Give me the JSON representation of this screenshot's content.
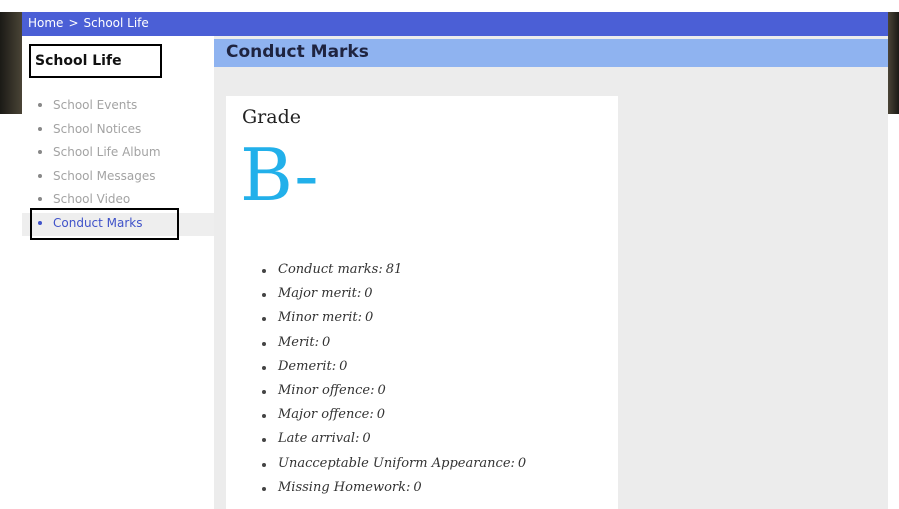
{
  "breadcrumb": {
    "home": "Home",
    "separator": ">",
    "current": "School Life"
  },
  "sidebar": {
    "title": "School Life",
    "items": [
      {
        "label": "School Events"
      },
      {
        "label": "School Notices"
      },
      {
        "label": "School Life Album"
      },
      {
        "label": "School Messages"
      },
      {
        "label": "School Video"
      },
      {
        "label": "Conduct Marks",
        "active": true
      }
    ]
  },
  "main": {
    "title": "Conduct Marks",
    "grade_heading": "Grade",
    "grade_value": "B-",
    "stats": [
      {
        "key": "Conduct marks",
        "value": "81"
      },
      {
        "key": "Major merit",
        "value": "0"
      },
      {
        "key": "Minor merit",
        "value": "0"
      },
      {
        "key": "Merit",
        "value": "0"
      },
      {
        "key": "Demerit",
        "value": "0"
      },
      {
        "key": "Minor offence",
        "value": "0"
      },
      {
        "key": "Major offence",
        "value": "0"
      },
      {
        "key": "Late arrival",
        "value": "0"
      },
      {
        "key": "Unacceptable Uniform Appearance",
        "value": "0"
      },
      {
        "key": "Missing Homework",
        "value": "0"
      }
    ]
  },
  "colors": {
    "topbar": "#4b5fd6",
    "header": "#8fb3f0",
    "grade": "#22b0ea",
    "active_link": "#3f52c9"
  }
}
